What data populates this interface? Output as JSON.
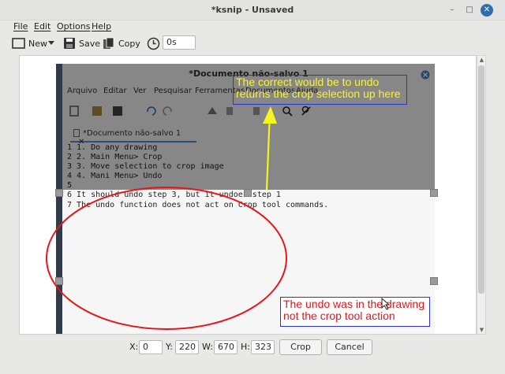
{
  "window": {
    "title": "*ksnip - Unsaved"
  },
  "menu": [
    "File",
    "Edit",
    "Options",
    "Help"
  ],
  "toolbar": {
    "new_label": "New",
    "save_label": "Save",
    "copy_label": "Copy",
    "delay_value": "0s"
  },
  "screenshot": {
    "gedit_title": "*Documento não-salvo 1",
    "gedit_menu": [
      "Arquivo",
      "Editar",
      "Ver",
      "Pesquisar",
      "Ferramentas",
      "Documentos",
      "Ajuda"
    ],
    "gedit_tab": "*Documento não-salvo 1",
    "lines": [
      "1 1. Do any drawing",
      "2 2. Main Menu> Crop",
      "3 3. Move selection to crop image",
      "4 4. Mani Menu> Undo",
      "5",
      "6 It should undo step 3, but it undoes step 1",
      "7 The undo function does not act on Crop tool commands."
    ]
  },
  "annotations": {
    "yellow_note": "The correct would be to undo returns the crop selection up here",
    "red_note": "The undo was in the drawing not the crop tool action"
  },
  "crop": {
    "x_label": "X:",
    "x_value": "0",
    "y_label": "Y:",
    "y_value": "220",
    "w_label": "W:",
    "w_value": "670",
    "h_label": "H:",
    "h_value": "323",
    "crop_button": "Crop",
    "cancel_button": "Cancel"
  },
  "colors": {
    "accent": "#2f6ea8",
    "annotation_yellow": "#f7f72a",
    "annotation_red": "#e8141a",
    "annotation_border": "#2b33c8"
  }
}
